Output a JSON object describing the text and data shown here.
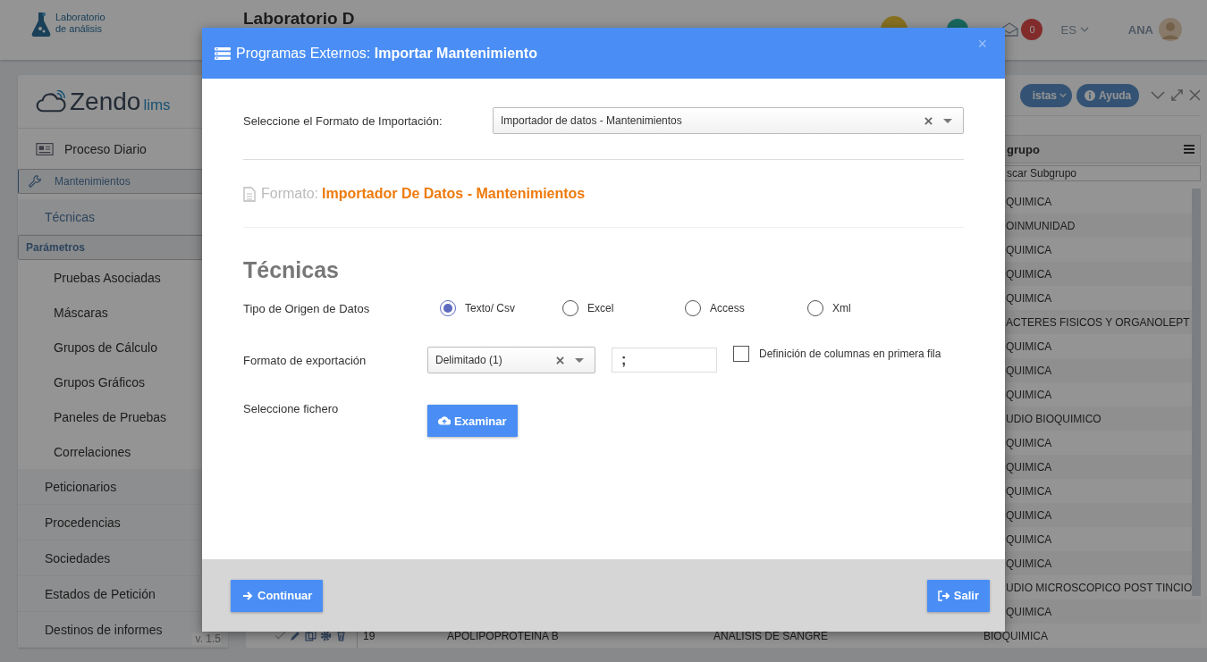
{
  "header": {
    "logo_line_1": "Laboratorio",
    "logo_line_2": "de análisis",
    "title": "Laboratorio D",
    "mail_count": "0",
    "language": "ES",
    "user": "ANA"
  },
  "sidebar": {
    "logo_main": "Zendo",
    "logo_suffix": "lims",
    "version": "v. 1.5",
    "items": [
      {
        "label": "Proceso Diario",
        "selected": false,
        "expanded": false
      },
      {
        "label": "Mantenimientos",
        "selected": true,
        "expanded": true,
        "children": [
          {
            "label": "Técnicas",
            "selected": false,
            "expanded": true,
            "children": [
              {
                "label": "Parámetros",
                "selected": true
              },
              {
                "label": "Pruebas Asociadas",
                "selected": false
              },
              {
                "label": "Máscaras",
                "selected": false
              },
              {
                "label": "Grupos de Cálculo",
                "selected": false
              },
              {
                "label": "Grupos Gráficos",
                "selected": false
              },
              {
                "label": "Paneles de Pruebas",
                "selected": false
              },
              {
                "label": "Correlaciones",
                "selected": false
              }
            ]
          },
          {
            "label": "Peticionarios",
            "selected": false,
            "expanded": false
          },
          {
            "label": "Procedencias",
            "selected": false,
            "expanded": false
          },
          {
            "label": "Sociedades",
            "selected": false,
            "expanded": false
          },
          {
            "label": "Estados de Petición",
            "selected": false,
            "expanded": false
          },
          {
            "label": "Destinos de informes",
            "selected": false,
            "expanded": false
          }
        ]
      }
    ]
  },
  "toolbar": {
    "buttons": [
      {
        "label": "istas",
        "kind": "dropdown"
      },
      {
        "label": "Ayuda",
        "kind": "help"
      }
    ]
  },
  "table": {
    "header": "grupo",
    "filter_placeholder": "scar Subgrupo",
    "rows": [
      {
        "subgroup": "QUIMICA"
      },
      {
        "subgroup": "OINMUNIDAD"
      },
      {
        "subgroup": "QUIMICA"
      },
      {
        "subgroup": "QUIMICA"
      },
      {
        "subgroup": "QUIMICA"
      },
      {
        "subgroup": "ACTERES FISICOS Y ORGANOLEPT"
      },
      {
        "subgroup": "QUIMICA"
      },
      {
        "subgroup": "QUIMICA"
      },
      {
        "subgroup": "QUIMICA"
      },
      {
        "subgroup": "UDIO BIOQUIMICO"
      },
      {
        "subgroup": "QUIMICA"
      },
      {
        "subgroup": "QUIMICA"
      },
      {
        "subgroup": "QUIMICA"
      },
      {
        "subgroup": "QUIMICA"
      },
      {
        "subgroup": "QUIMICA"
      },
      {
        "subgroup": "QUIMICA"
      },
      {
        "subgroup": "UDIO MICROSCOPICO POST TINCIO"
      },
      {
        "subgroup": "QUIMICA"
      },
      {
        "number": "19",
        "name": "APOLIPOPROTEINA B",
        "origin": "ANALISIS DE SANGRE",
        "subgroup": "BIOQUIMICA"
      }
    ]
  },
  "dialog": {
    "title_prefix": "Programas Externos:",
    "title": "Importar Mantenimiento",
    "close": "×",
    "import_format": {
      "label": "Seleccione el Formato de Importación:",
      "value": "Importador de datos - Mantenimientos"
    },
    "format": {
      "label": "Formato:",
      "name": "Importador De Datos - Mantenimientos"
    },
    "section_title": "Técnicas",
    "source": {
      "label": "Tipo de Origen de Datos",
      "options": [
        {
          "label": "Texto/ Csv",
          "selected": true
        },
        {
          "label": "Excel",
          "selected": false
        },
        {
          "label": "Access",
          "selected": false
        },
        {
          "label": "Xml",
          "selected": false
        }
      ]
    },
    "export": {
      "label": "Formato de exportación",
      "value": "Delimitado (1)",
      "delimiter": ";",
      "header_row": {
        "label": "Definición de columnas en primera fila",
        "checked": false
      }
    },
    "file": {
      "label": "Seleccione fichero",
      "button": "Examinar"
    },
    "footer_buttons": [
      {
        "label": "Continuar",
        "kind": "continue"
      },
      {
        "label": "Salir",
        "kind": "exit"
      }
    ]
  }
}
